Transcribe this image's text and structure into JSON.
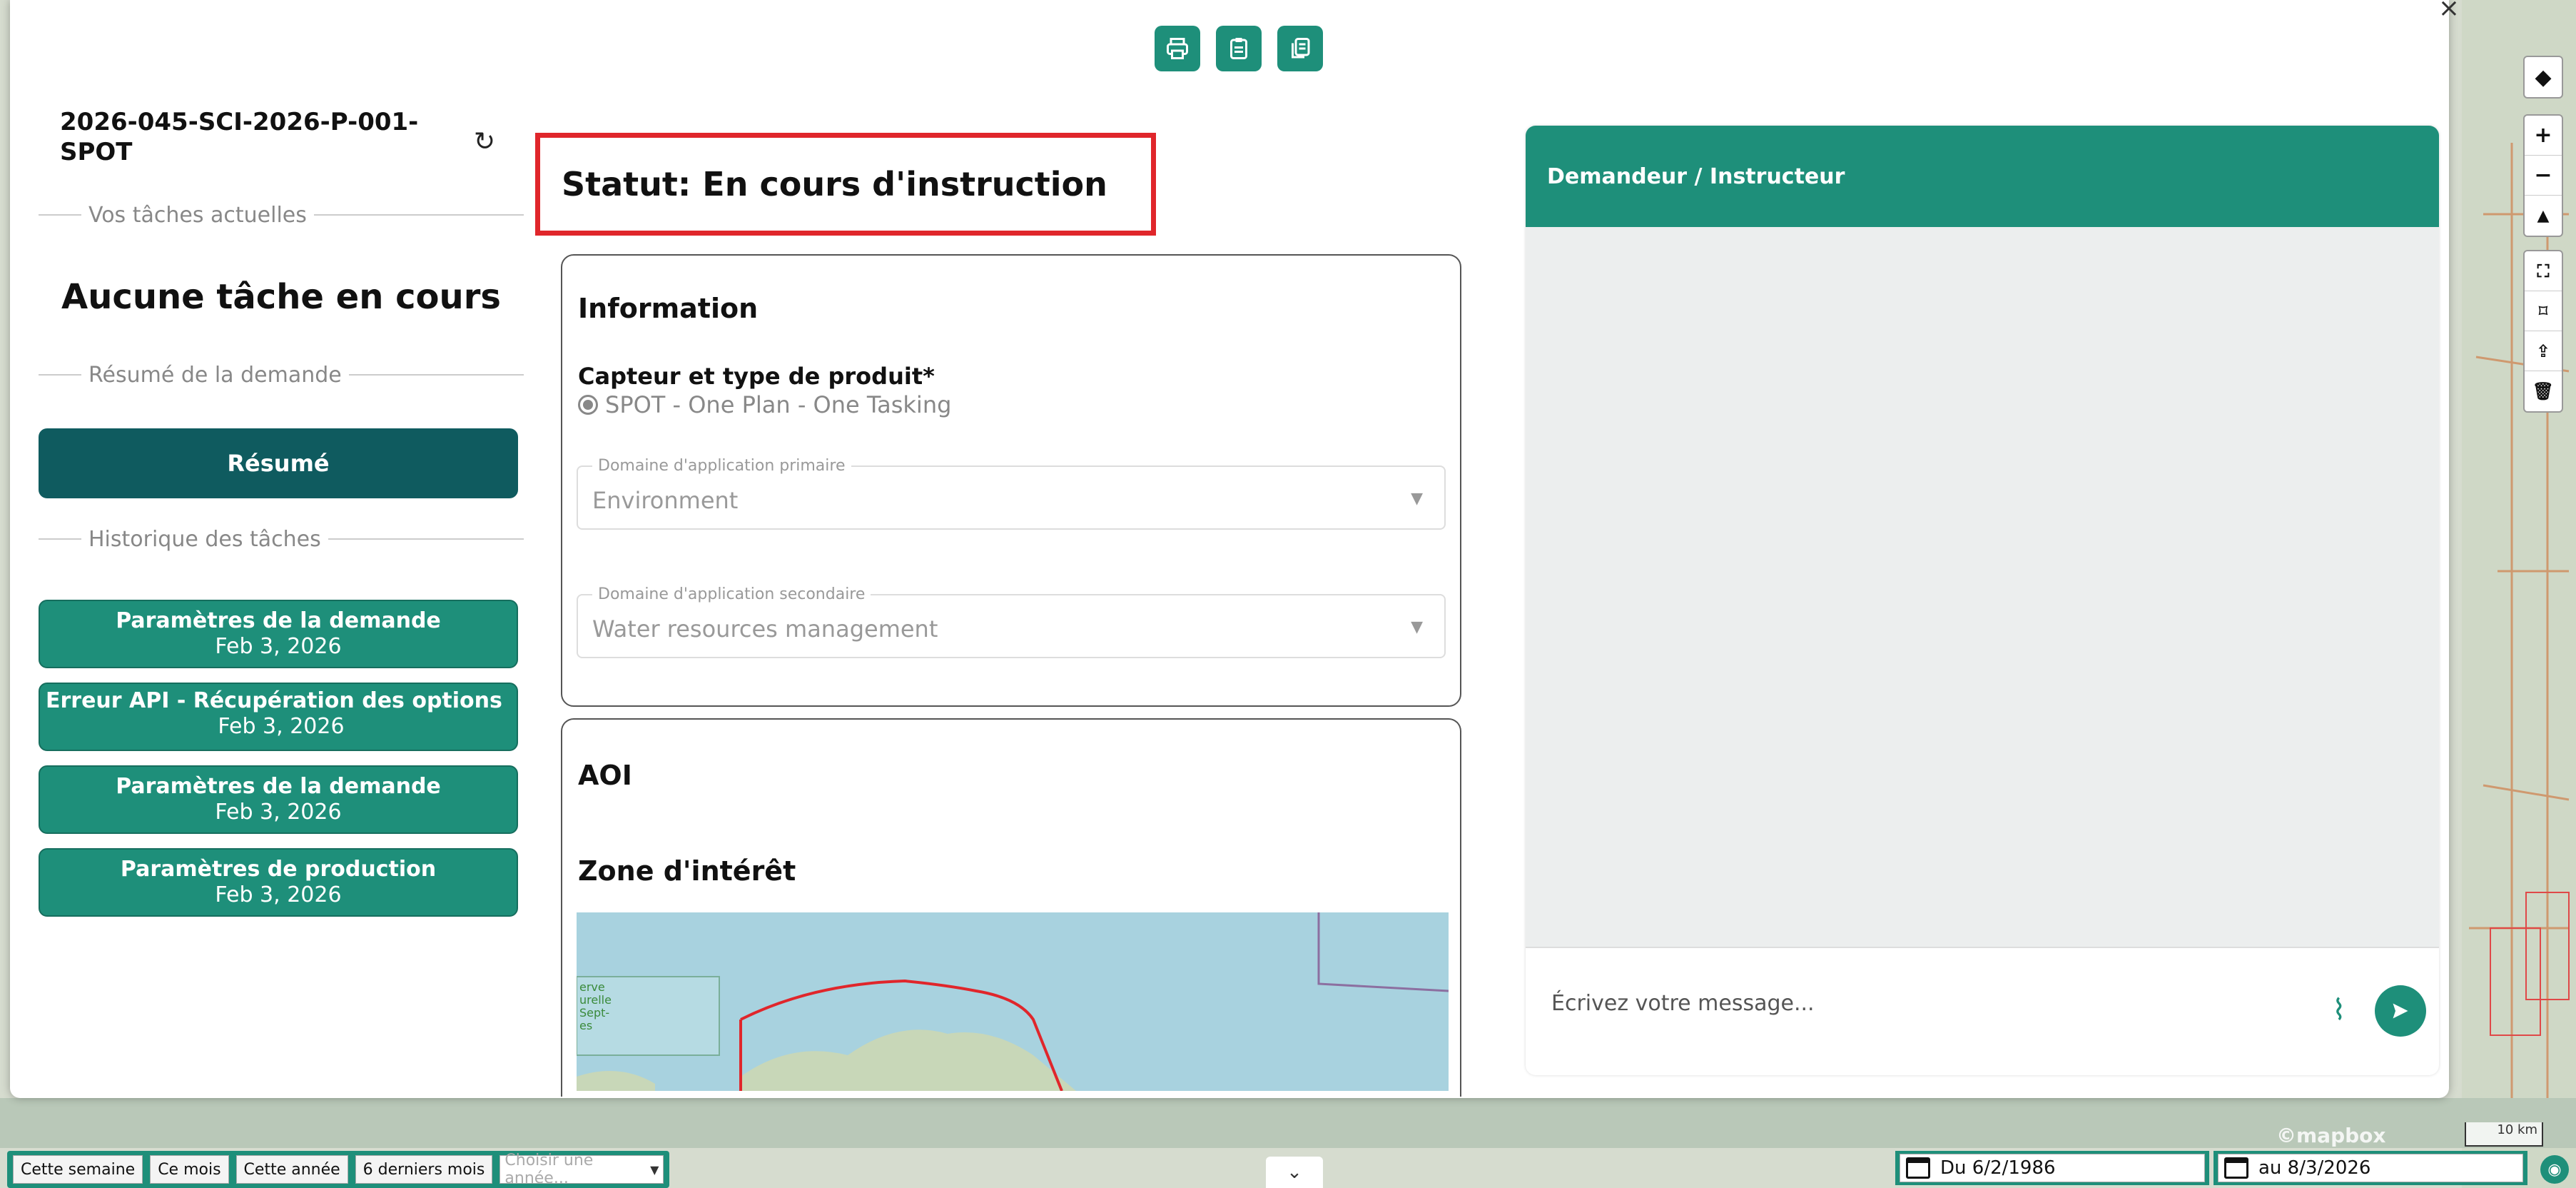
{
  "request": {
    "id": "2026-045-SCI-2026-P-001-SPOT",
    "status": "Statut: En cours d'instruction"
  },
  "left": {
    "current_tasks_label": "Vos tâches actuelles",
    "no_task": "Aucune tâche en cours",
    "summary_section_label": "Résumé de la demande",
    "summary_button": "Résumé",
    "history_label": "Historique des tâches",
    "history": [
      {
        "title": "Paramètres de la demande",
        "date": "Feb 3, 2026"
      },
      {
        "title": "Erreur API - Récupération des options",
        "date": "Feb 3, 2026"
      },
      {
        "title": "Paramètres de la demande",
        "date": "Feb 3, 2026"
      },
      {
        "title": "Paramètres de production",
        "date": "Feb 3, 2026"
      }
    ]
  },
  "info": {
    "title": "Information",
    "sensor_label": "Capteur et type de produit*",
    "sensor_value": "SPOT - One Plan - One Tasking",
    "primary_domain_label": "Domaine d'application primaire",
    "primary_domain_value": "Environment",
    "secondary_domain_label": "Domaine d'application secondaire",
    "secondary_domain_value": "Water resources management"
  },
  "aoi": {
    "title": "AOI",
    "zone_label": "Zone d'intérêt",
    "map_text": "erve\nurelle\nSept-\nes"
  },
  "chat": {
    "header": "Demandeur / Instructeur",
    "placeholder": "Écrivez votre message..."
  },
  "bottom": {
    "filters": [
      "Cette semaine",
      "Ce mois",
      "Cette année",
      "6 derniers mois"
    ],
    "year_placeholder": "Choisir une année...",
    "date_from": "Du 6/2/1986",
    "date_to": "au 8/3/2026",
    "scale": "10 km",
    "mapbox": "©mapbox"
  },
  "icons": {
    "top": [
      "print-icon",
      "clipboard-icon",
      "copy-icon"
    ],
    "map_controls": [
      "layers-icon",
      "zoom-in-icon",
      "zoom-out-icon",
      "compass-icon",
      "fullscreen-icon",
      "draw-polygon-icon",
      "upload-icon",
      "trash-icon"
    ]
  },
  "colors": {
    "accent": "#1e8f7a",
    "dark_accent": "#0f5b5f",
    "status_outline": "#e0262b"
  }
}
